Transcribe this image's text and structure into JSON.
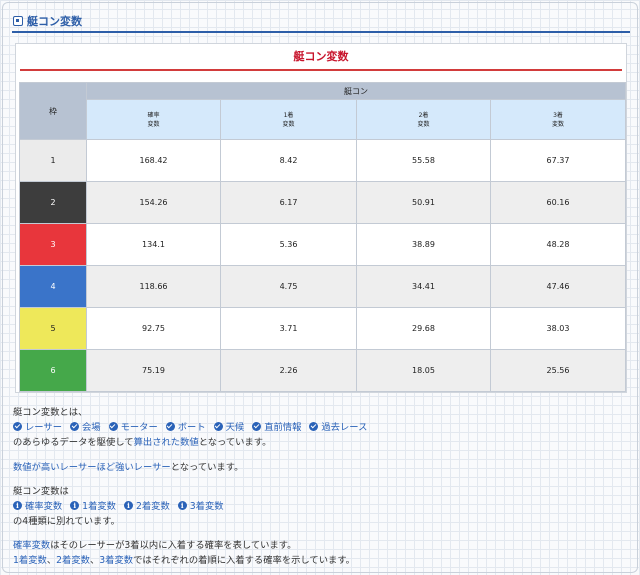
{
  "header": {
    "title": "艇コン変数"
  },
  "panel": {
    "title": "艇コン変数"
  },
  "table": {
    "frame_header": "枠",
    "group_header": "艇コン",
    "columns": [
      {
        "line1": "確率",
        "line2": "変数"
      },
      {
        "line1": "1着",
        "line2": "変数"
      },
      {
        "line1": "2着",
        "line2": "変数"
      },
      {
        "line1": "3着",
        "line2": "変数"
      }
    ],
    "rows": [
      {
        "frame": "1",
        "values": [
          "168.42",
          "8.42",
          "55.58",
          "67.37"
        ]
      },
      {
        "frame": "2",
        "values": [
          "154.26",
          "6.17",
          "50.91",
          "60.16"
        ]
      },
      {
        "frame": "3",
        "values": [
          "134.1",
          "5.36",
          "38.89",
          "48.28"
        ]
      },
      {
        "frame": "4",
        "values": [
          "118.66",
          "4.75",
          "34.41",
          "47.46"
        ]
      },
      {
        "frame": "5",
        "values": [
          "92.75",
          "3.71",
          "29.68",
          "38.03"
        ]
      },
      {
        "frame": "6",
        "values": [
          "75.19",
          "2.26",
          "18.05",
          "25.56"
        ]
      }
    ],
    "frame_colors": [
      {
        "bg": "#ebebeb",
        "fg": "#222222"
      },
      {
        "bg": "#3d3d3d",
        "fg": "#ffffff"
      },
      {
        "bg": "#e8363c",
        "fg": "#ffffff"
      },
      {
        "bg": "#3a74c9",
        "fg": "#ffffff"
      },
      {
        "bg": "#eee85a",
        "fg": "#222222"
      },
      {
        "bg": "#45a84a",
        "fg": "#ffffff"
      }
    ]
  },
  "description": {
    "intro": "艇コン変数とは、",
    "factors": [
      "レーサー",
      "会場",
      "モーター",
      "ボート",
      "天候",
      "直前情報",
      "過去レース"
    ],
    "line3_a": "のあらゆるデータを駆使して",
    "line3_b": "算出された数値",
    "line3_c": "となっています。",
    "line4_a": "数値が高いレーサーほど強いレーサー",
    "line4_b": "となっています。",
    "line5": "艇コン変数は",
    "kinds": [
      "確率変数",
      "1着変数",
      "2着変数",
      "3着変数"
    ],
    "line7": "の4種類に別れています。",
    "line8_a": "確率変数",
    "line8_b": "はそのレーサーが3着以内に入着する確率を表しています。",
    "line9_a": "1着変数",
    "line9_sep1": "、",
    "line9_b": "2着変数",
    "line9_sep2": "、",
    "line9_c": "3着変数",
    "line9_d": "ではそれぞれの着順に入着する確率を示しています。"
  }
}
